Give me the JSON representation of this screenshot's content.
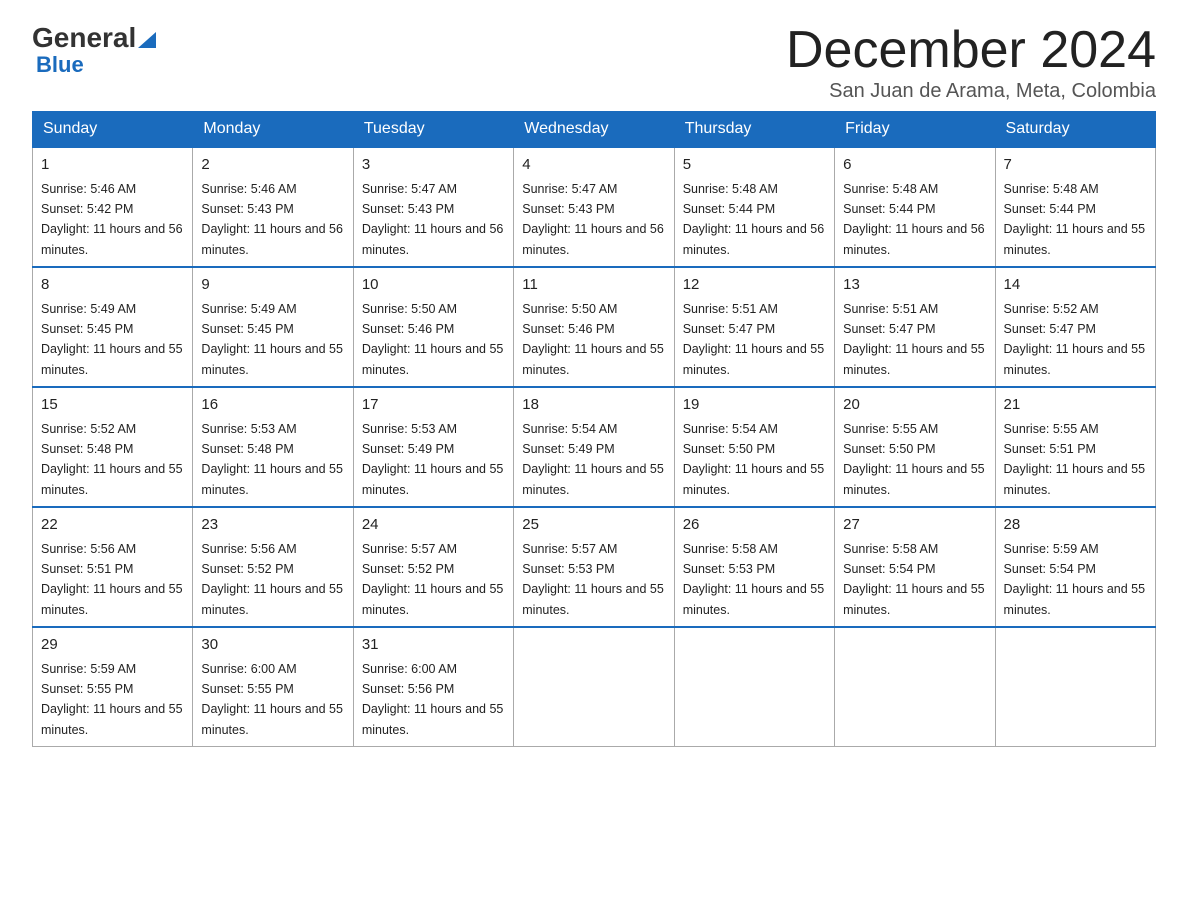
{
  "logo": {
    "general": "General",
    "arrow": "▲",
    "blue": "Blue"
  },
  "title": "December 2024",
  "location": "San Juan de Arama, Meta, Colombia",
  "weekdays": [
    "Sunday",
    "Monday",
    "Tuesday",
    "Wednesday",
    "Thursday",
    "Friday",
    "Saturday"
  ],
  "weeks": [
    [
      {
        "day": "1",
        "sunrise": "5:46 AM",
        "sunset": "5:42 PM",
        "daylight": "11 hours and 56 minutes."
      },
      {
        "day": "2",
        "sunrise": "5:46 AM",
        "sunset": "5:43 PM",
        "daylight": "11 hours and 56 minutes."
      },
      {
        "day": "3",
        "sunrise": "5:47 AM",
        "sunset": "5:43 PM",
        "daylight": "11 hours and 56 minutes."
      },
      {
        "day": "4",
        "sunrise": "5:47 AM",
        "sunset": "5:43 PM",
        "daylight": "11 hours and 56 minutes."
      },
      {
        "day": "5",
        "sunrise": "5:48 AM",
        "sunset": "5:44 PM",
        "daylight": "11 hours and 56 minutes."
      },
      {
        "day": "6",
        "sunrise": "5:48 AM",
        "sunset": "5:44 PM",
        "daylight": "11 hours and 56 minutes."
      },
      {
        "day": "7",
        "sunrise": "5:48 AM",
        "sunset": "5:44 PM",
        "daylight": "11 hours and 55 minutes."
      }
    ],
    [
      {
        "day": "8",
        "sunrise": "5:49 AM",
        "sunset": "5:45 PM",
        "daylight": "11 hours and 55 minutes."
      },
      {
        "day": "9",
        "sunrise": "5:49 AM",
        "sunset": "5:45 PM",
        "daylight": "11 hours and 55 minutes."
      },
      {
        "day": "10",
        "sunrise": "5:50 AM",
        "sunset": "5:46 PM",
        "daylight": "11 hours and 55 minutes."
      },
      {
        "day": "11",
        "sunrise": "5:50 AM",
        "sunset": "5:46 PM",
        "daylight": "11 hours and 55 minutes."
      },
      {
        "day": "12",
        "sunrise": "5:51 AM",
        "sunset": "5:47 PM",
        "daylight": "11 hours and 55 minutes."
      },
      {
        "day": "13",
        "sunrise": "5:51 AM",
        "sunset": "5:47 PM",
        "daylight": "11 hours and 55 minutes."
      },
      {
        "day": "14",
        "sunrise": "5:52 AM",
        "sunset": "5:47 PM",
        "daylight": "11 hours and 55 minutes."
      }
    ],
    [
      {
        "day": "15",
        "sunrise": "5:52 AM",
        "sunset": "5:48 PM",
        "daylight": "11 hours and 55 minutes."
      },
      {
        "day": "16",
        "sunrise": "5:53 AM",
        "sunset": "5:48 PM",
        "daylight": "11 hours and 55 minutes."
      },
      {
        "day": "17",
        "sunrise": "5:53 AM",
        "sunset": "5:49 PM",
        "daylight": "11 hours and 55 minutes."
      },
      {
        "day": "18",
        "sunrise": "5:54 AM",
        "sunset": "5:49 PM",
        "daylight": "11 hours and 55 minutes."
      },
      {
        "day": "19",
        "sunrise": "5:54 AM",
        "sunset": "5:50 PM",
        "daylight": "11 hours and 55 minutes."
      },
      {
        "day": "20",
        "sunrise": "5:55 AM",
        "sunset": "5:50 PM",
        "daylight": "11 hours and 55 minutes."
      },
      {
        "day": "21",
        "sunrise": "5:55 AM",
        "sunset": "5:51 PM",
        "daylight": "11 hours and 55 minutes."
      }
    ],
    [
      {
        "day": "22",
        "sunrise": "5:56 AM",
        "sunset": "5:51 PM",
        "daylight": "11 hours and 55 minutes."
      },
      {
        "day": "23",
        "sunrise": "5:56 AM",
        "sunset": "5:52 PM",
        "daylight": "11 hours and 55 minutes."
      },
      {
        "day": "24",
        "sunrise": "5:57 AM",
        "sunset": "5:52 PM",
        "daylight": "11 hours and 55 minutes."
      },
      {
        "day": "25",
        "sunrise": "5:57 AM",
        "sunset": "5:53 PM",
        "daylight": "11 hours and 55 minutes."
      },
      {
        "day": "26",
        "sunrise": "5:58 AM",
        "sunset": "5:53 PM",
        "daylight": "11 hours and 55 minutes."
      },
      {
        "day": "27",
        "sunrise": "5:58 AM",
        "sunset": "5:54 PM",
        "daylight": "11 hours and 55 minutes."
      },
      {
        "day": "28",
        "sunrise": "5:59 AM",
        "sunset": "5:54 PM",
        "daylight": "11 hours and 55 minutes."
      }
    ],
    [
      {
        "day": "29",
        "sunrise": "5:59 AM",
        "sunset": "5:55 PM",
        "daylight": "11 hours and 55 minutes."
      },
      {
        "day": "30",
        "sunrise": "6:00 AM",
        "sunset": "5:55 PM",
        "daylight": "11 hours and 55 minutes."
      },
      {
        "day": "31",
        "sunrise": "6:00 AM",
        "sunset": "5:56 PM",
        "daylight": "11 hours and 55 minutes."
      },
      null,
      null,
      null,
      null
    ]
  ]
}
